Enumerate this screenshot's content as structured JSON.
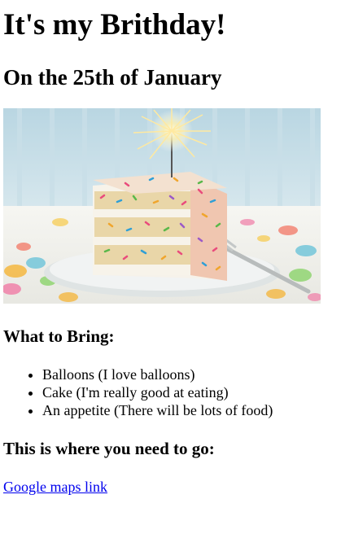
{
  "page": {
    "title": "It's my Brithday!",
    "subtitle": "On the 25th of January",
    "image": {
      "icon": "birthday-cake-with-sparkler",
      "colors": {
        "background_wall": "#a9c9d6",
        "table": "#f2f2ee",
        "plate": "#e9ecec",
        "frosting": "#f7f4ee",
        "cake": "#eadbb7",
        "sparkle": "#fff4c2"
      }
    },
    "bring_heading": "What to Bring:",
    "bring_items": [
      "Balloons (I love balloons)",
      "Cake (I'm really good at eating)",
      "An appetite (There will be lots of food)"
    ],
    "directions_heading": "This is where you need to go:",
    "map_link_text": "Google maps link"
  }
}
